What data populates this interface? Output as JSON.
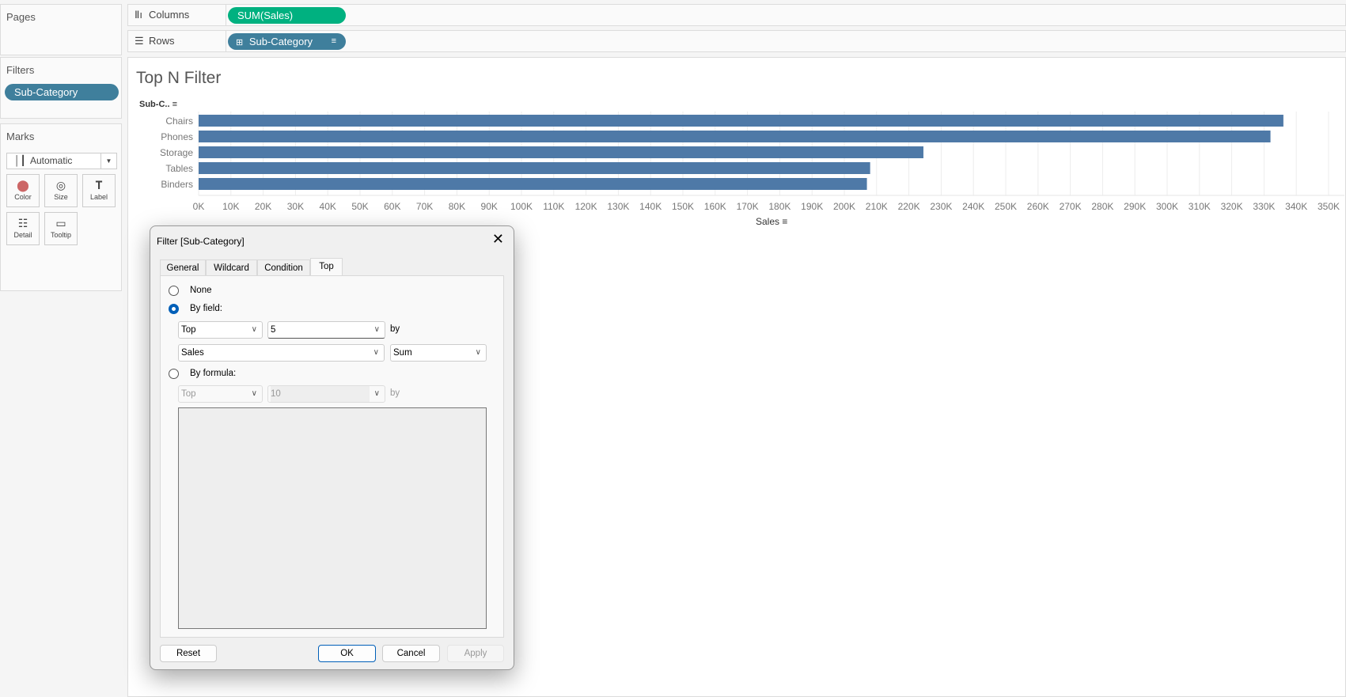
{
  "left": {
    "pages_title": "Pages",
    "filters_title": "Filters",
    "filter_pill": "Sub-Category",
    "marks_title": "Marks",
    "mark_type": "Automatic",
    "mark_buttons": [
      "Color",
      "Size",
      "Label",
      "Detail",
      "Tooltip"
    ]
  },
  "shelves": {
    "columns_label": "Columns",
    "columns_pill": "SUM(Sales)",
    "rows_label": "Rows",
    "rows_pill": "Sub-Category"
  },
  "colors": {
    "measure_pill": "#00b180",
    "dimension_pill": "#3f7f9c",
    "bar": "#4e79a7"
  },
  "viz": {
    "title": "Top N Filter",
    "row_header": "Sub-C..",
    "xlabel": "Sales"
  },
  "chart_data": {
    "type": "bar",
    "orientation": "horizontal",
    "categories": [
      "Chairs",
      "Phones",
      "Storage",
      "Tables",
      "Binders"
    ],
    "values": [
      336000,
      332000,
      224500,
      208000,
      207000
    ],
    "xlabel": "Sales",
    "ylabel": "Sub-C..",
    "xlim": [
      0,
      350000
    ],
    "ticks": [
      "0K",
      "10K",
      "20K",
      "30K",
      "40K",
      "50K",
      "60K",
      "70K",
      "80K",
      "90K",
      "100K",
      "110K",
      "120K",
      "130K",
      "140K",
      "150K",
      "160K",
      "170K",
      "180K",
      "190K",
      "200K",
      "210K",
      "220K",
      "230K",
      "240K",
      "250K",
      "260K",
      "270K",
      "280K",
      "290K",
      "300K",
      "310K",
      "320K",
      "330K",
      "340K",
      "350K"
    ],
    "grid": true
  },
  "dialog": {
    "title": "Filter [Sub-Category]",
    "tabs": [
      "General",
      "Wildcard",
      "Condition",
      "Top"
    ],
    "selected_tab": "Top",
    "none_label": "None",
    "by_field_label": "By field:",
    "by_field": {
      "direction": "Top",
      "count": "5",
      "by": "by",
      "field": "Sales",
      "aggregation": "Sum"
    },
    "by_formula_label": "By formula:",
    "by_formula": {
      "direction": "Top",
      "count": "10",
      "by": "by",
      "formula": ""
    },
    "selected_option": "By field:",
    "buttons": {
      "reset": "Reset",
      "ok": "OK",
      "cancel": "Cancel",
      "apply": "Apply"
    }
  }
}
